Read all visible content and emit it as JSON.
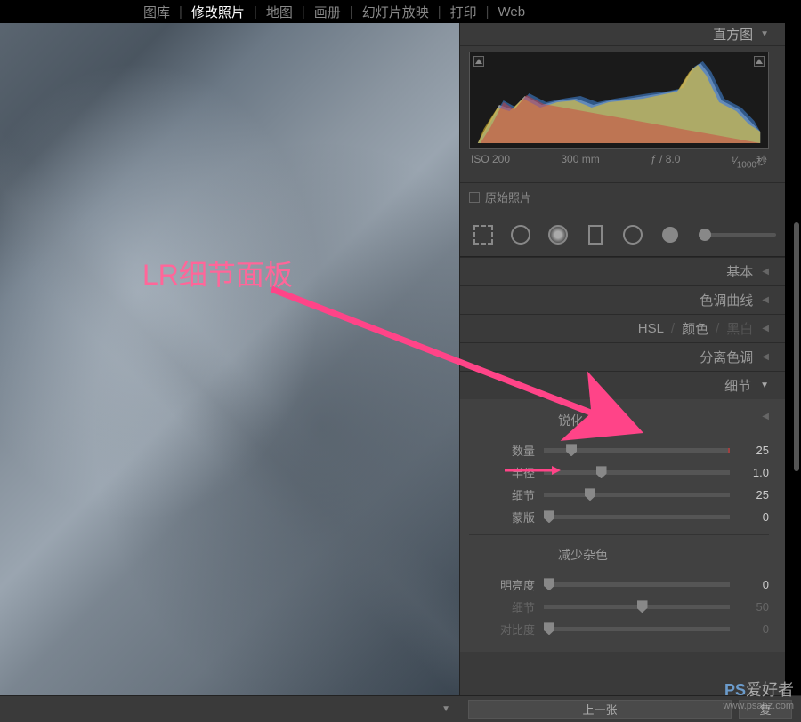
{
  "menu": {
    "library": "图库",
    "develop": "修改照片",
    "map": "地图",
    "book": "画册",
    "slideshow": "幻灯片放映",
    "print": "打印",
    "web": "Web"
  },
  "annotation": {
    "title": "LR细节面板"
  },
  "histogram": {
    "header": "直方图",
    "iso": "ISO 200",
    "focal": "300 mm",
    "aperture": "ƒ / 8.0",
    "shutter_pre": "¹⁄",
    "shutter_val": "1000",
    "shutter_unit": "秒",
    "original": "原始照片"
  },
  "panels": {
    "basic": "基本",
    "tone_curve": "色调曲线",
    "hsl": "HSL",
    "color": "颜色",
    "bw": "黑白",
    "split_toning": "分离色调",
    "detail": "细节"
  },
  "detail": {
    "sharpening": {
      "label": "锐化",
      "amount": {
        "label": "数量",
        "value": "25",
        "pos": 12
      },
      "radius": {
        "label": "半径",
        "value": "1.0",
        "pos": 28
      },
      "detail": {
        "label": "细节",
        "value": "25",
        "pos": 22
      },
      "masking": {
        "label": "蒙版",
        "value": "0",
        "pos": 0
      }
    },
    "noise": {
      "label": "减少杂色",
      "luminance": {
        "label": "明亮度",
        "value": "0",
        "pos": 0
      },
      "detail_n": {
        "label": "细节",
        "value": "50",
        "pos": 50
      },
      "contrast": {
        "label": "对比度",
        "value": "0",
        "pos": 0
      }
    }
  },
  "bottom": {
    "prev": "上一张",
    "reset": "复"
  },
  "watermark": {
    "main_a": "PS",
    "main_b": "爱好者",
    "url": "www.psahz.com"
  }
}
